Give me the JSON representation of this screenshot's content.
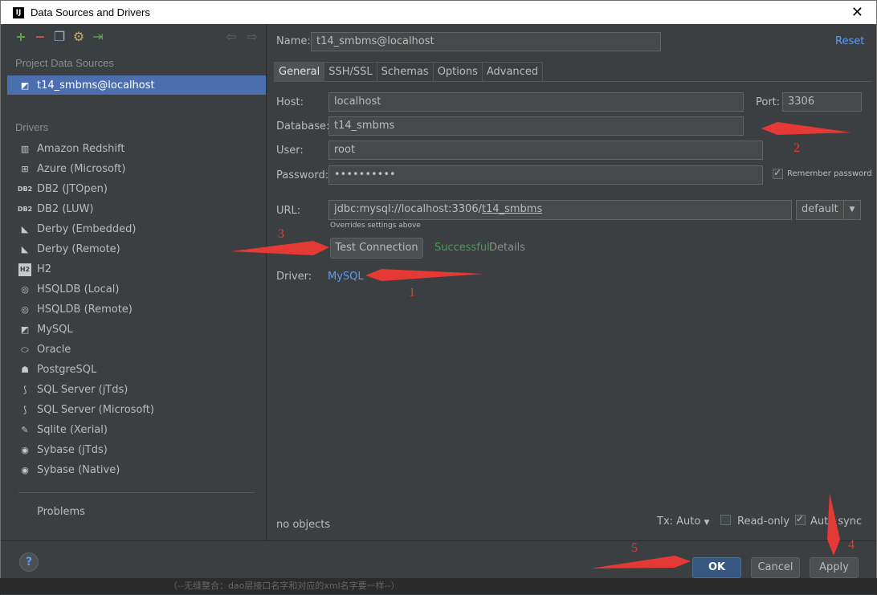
{
  "window": {
    "title": "Data Sources and Drivers",
    "app_icon": "IJ"
  },
  "left": {
    "project_section": "Project Data Sources",
    "selected_source": "t14_smbms@localhost",
    "drivers_section": "Drivers",
    "drivers": [
      "Amazon Redshift",
      "Azure (Microsoft)",
      "DB2 (JTOpen)",
      "DB2 (LUW)",
      "Derby (Embedded)",
      "Derby (Remote)",
      "H2",
      "HSQLDB (Local)",
      "HSQLDB (Remote)",
      "MySQL",
      "Oracle",
      "PostgreSQL",
      "SQL Server (jTds)",
      "SQL Server (Microsoft)",
      "Sqlite (Xerial)",
      "Sybase (jTds)",
      "Sybase (Native)"
    ],
    "problems": "Problems"
  },
  "form": {
    "name_label": "Name:",
    "name_value": "t14_smbms@localhost",
    "reset": "Reset",
    "tabs": [
      "General",
      "SSH/SSL",
      "Schemas",
      "Options",
      "Advanced"
    ],
    "host_label": "Host:",
    "host_value": "localhost",
    "port_label": "Port:",
    "port_value": "3306",
    "database_label": "Database:",
    "database_value": "t14_smbms",
    "user_label": "User:",
    "user_value": "root",
    "password_label": "Password:",
    "password_value": "••••••••••",
    "remember_password": "Remember password",
    "url_label": "URL:",
    "url_value_prefix": "jdbc:mysql://localhost:3306/",
    "url_value_db": "t14_smbms",
    "url_mode": "default",
    "url_hint": "Overrides settings above",
    "test_connection": "Test Connection",
    "test_status": "Successful",
    "details": "Details",
    "driver_label": "Driver:",
    "driver_value": "MySQL",
    "objects": "no objects",
    "tx": "Tx: Auto",
    "read_only": "Read-only",
    "auto_sync": "Auto sync"
  },
  "buttons": {
    "ok": "OK",
    "cancel": "Cancel",
    "apply": "Apply",
    "help": "?"
  },
  "annotations": [
    "1",
    "2",
    "3",
    "4",
    "5"
  ],
  "background_text": "（--无缝整合：dao层接口名字和对应的xml名字要一样--）",
  "colors": {
    "accent": "#4b6eaf",
    "link": "#589df6",
    "success": "#499c54",
    "annotation": "#e53935"
  }
}
